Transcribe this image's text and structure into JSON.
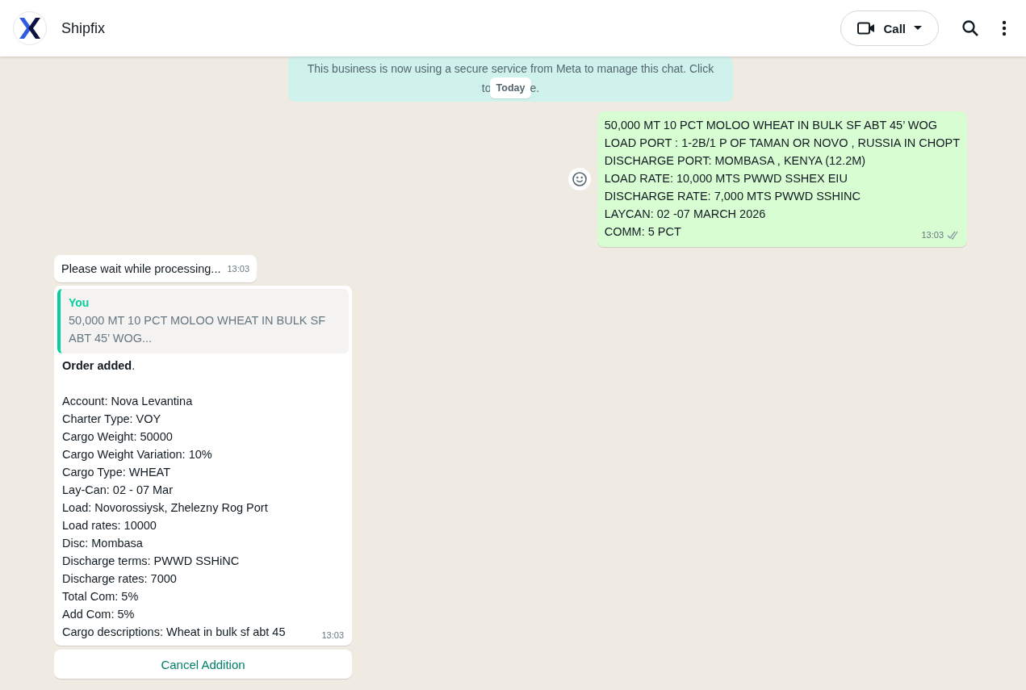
{
  "header": {
    "title": "Shipfix",
    "call_button": "Call"
  },
  "notice": {
    "line_1": "This business is now using a secure service from Meta to manage this chat. Click",
    "line_2_start": "to",
    "line_2_end": "e."
  },
  "date_pill": "Today",
  "messages": [
    {
      "kind": "outgoing",
      "lines": [
        "50,000 MT 10 PCT MOLOO WHEAT IN BULK SF ABT 45’ WOG",
        "LOAD PORT : 1-2B/1 P OF TAMAN OR NOVO , RUSSIA IN CHOPT",
        "DISCHARGE PORT: MOMBASA , KENYA (12.2M)",
        "LOAD RATE: 10,000 MTS PWWD SSHEX EIU",
        "DISCHARGE RATE: 7,000 MTS PWWD SSHINC",
        "LAYCAN: 02 -07 MARCH 2026",
        "COMM: 5 PCT"
      ],
      "time": "13:03",
      "read": false
    },
    {
      "kind": "incoming",
      "lines": [
        "Please wait while processing..."
      ],
      "time": "13:03"
    },
    {
      "kind": "reply",
      "quote": {
        "author": "You",
        "text": "50,000 MT 10 PCT MOLOO WHEAT IN BULK SF ABT 45’ WOG..."
      },
      "heading": "**Order added**.",
      "lines": [
        "Account: Nova Levantina",
        "Charter Type: VOY",
        "Cargo Weight: 50000",
        "Cargo Weight Variation: 10%",
        "Cargo Type: WHEAT",
        "Lay-Can: 02 - 07 Mar",
        "Load: Novorossiysk, Zhelezny Rog Port",
        "Load rates: 10000",
        "Disc: Mombasa",
        "Discharge terms: PWWD SSHiNC",
        "Discharge rates: 7000",
        "Total Com: 5%",
        "Add Com: 5%",
        "Cargo descriptions: Wheat in bulk sf abt 45"
      ],
      "time": "13:03",
      "button": "Cancel Addition"
    }
  ]
}
